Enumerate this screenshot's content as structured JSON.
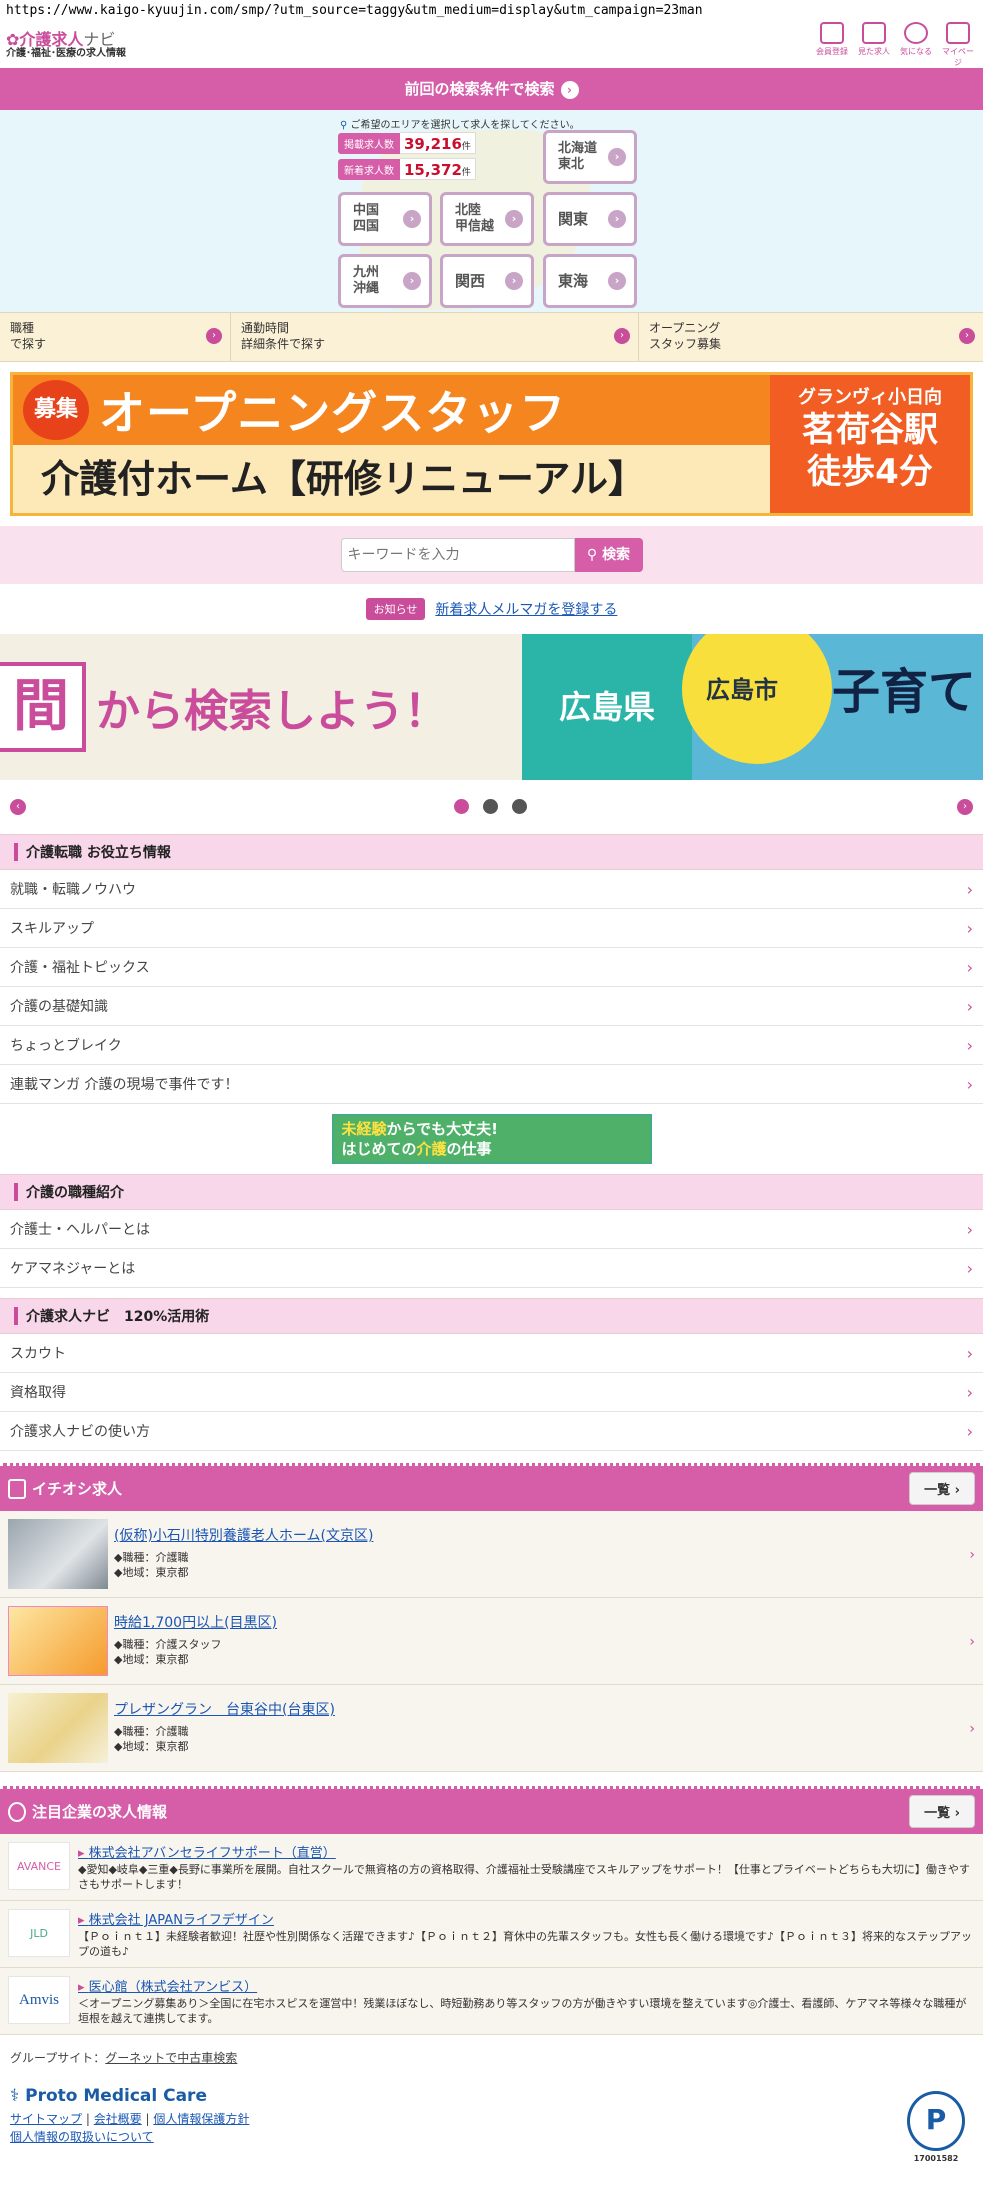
{
  "url": "https://www.kaigo-kyuujin.com/smp/?utm_source=taggy&utm_medium=display&utm_campaign=23man",
  "header": {
    "logo_main": "介護求人",
    "logo_accent": "ナビ",
    "logo_sub": "介護･福祉･医療の求人情報",
    "icons": [
      {
        "label": "会員登録",
        "icon": "pen-icon"
      },
      {
        "label": "見た求人",
        "icon": "calendar-icon"
      },
      {
        "label": "気になる",
        "icon": "heart-icon"
      },
      {
        "label": "マイページ",
        "icon": "mypage-icon"
      }
    ]
  },
  "prev_search": "前回の検索条件で検索",
  "area": {
    "hint": "ご希望のエリアを選択して求人を探してください。",
    "total_label": "掲載求人数",
    "total_value": "39,216",
    "new_label": "新着求人数",
    "new_value": "15,372",
    "unit": "件",
    "regions": [
      "北海道\n東北",
      "中国\n四国",
      "北陸\n甲信越",
      "関東",
      "九州\n沖縄",
      "関西",
      "東海"
    ]
  },
  "search_links": [
    {
      "label": "職種\nで探す"
    },
    {
      "label": "通勤時間\n詳細条件で探す"
    },
    {
      "label": "オープニング\nスタッフ募集"
    }
  ],
  "banner": {
    "badge": "募集",
    "headline": "オープニングスタッフ",
    "sub": "介護付ホーム【研修リニューアル】",
    "right_top": "グランヴィ小日向",
    "right_main": "茗荷谷駅\n徒歩4分"
  },
  "keyword": {
    "placeholder": "キーワードを入力",
    "button": "検索"
  },
  "notice": {
    "tag": "お知らせ",
    "link": "新着求人メルマガを登録する"
  },
  "carousel": {
    "slide1_box": "間",
    "slide1_text": "から検索しよう！",
    "slide2": "広島県",
    "slide3_circle": "広島市",
    "slide3_text": "子育て"
  },
  "sections": {
    "tips": {
      "title": "介護転職 お役立ち情報",
      "items": [
        "就職・転職ノウハウ",
        "スキルアップ",
        "介護・福祉トピックス",
        "介護の基礎知識",
        "ちょっとブレイク",
        "連載マンガ 介護の現場で事件です！"
      ]
    },
    "mid_banner": {
      "line1_a": "未経験",
      "line1_b": "からでも大丈夫!",
      "line2_a": "はじめての",
      "line2_b": "介護",
      "line2_c": "の仕事"
    },
    "jobs": {
      "title": "介護の職種紹介",
      "items": [
        "介護士・ヘルパーとは",
        "ケアマネジャーとは"
      ]
    },
    "usage": {
      "title": "介護求人ナビ　120%活用術",
      "items": [
        "スカウト",
        "資格取得",
        "介護求人ナビの使い方"
      ]
    }
  },
  "pickup": {
    "title": "イチオシ求人",
    "more": "一覧",
    "items": [
      {
        "title": "(仮称)小石川特別養護老人ホーム(文京区)",
        "job": "◆職種：介護職",
        "area": "◆地域：東京都"
      },
      {
        "title": "時給1,700円以上(目黒区)",
        "job": "◆職種：介護スタッフ",
        "area": "◆地域：東京都"
      },
      {
        "title": "プレザングラン　台東谷中(台東区)",
        "job": "◆職種：介護職",
        "area": "◆地域：東京都"
      }
    ]
  },
  "companies": {
    "title": "注目企業の求人情報",
    "more": "一覧",
    "items": [
      {
        "name": "株式会社アバンセライフサポート（直営）",
        "desc": "◆愛知◆岐阜◆三重◆長野に事業所を展開。自社スクールで無資格の方の資格取得、介護福祉士受験講座でスキルアップをサポート！【仕事とプライベートどちらも大切に】働きやすさもサポートします！",
        "logo": "AVANCE"
      },
      {
        "name": "株式会社 JAPANライフデザイン",
        "desc": "【Ｐｏｉｎｔ１】未経験者歓迎！社歴や性別関係なく活躍できます♪【Ｐｏｉｎｔ２】育休中の先輩スタッフも。女性も長く働ける環境です♪【Ｐｏｉｎｔ３】将来的なステップアップの道も♪",
        "logo": "JLD"
      },
      {
        "name": "医心館（株式会社アンビス）",
        "desc": "＜オープニング募集あり＞全国に在宅ホスピスを運営中！残業ほぼなし、時短勤務あり等スタッフの方が働きやすい環境を整えています◎介護士、看護師、ケアマネ等様々な職種が垣根を越えて連携してます。",
        "logo": "Amvis"
      }
    ]
  },
  "footer": {
    "group_label": "グループサイト：",
    "group_link": "グーネットで中古車検索",
    "brand": "Proto Medical Care",
    "links": [
      "サイトマップ",
      "会社概要",
      "個人情報保護方針",
      "個人情報の取扱いについて"
    ],
    "pmark_number": "17001582"
  }
}
